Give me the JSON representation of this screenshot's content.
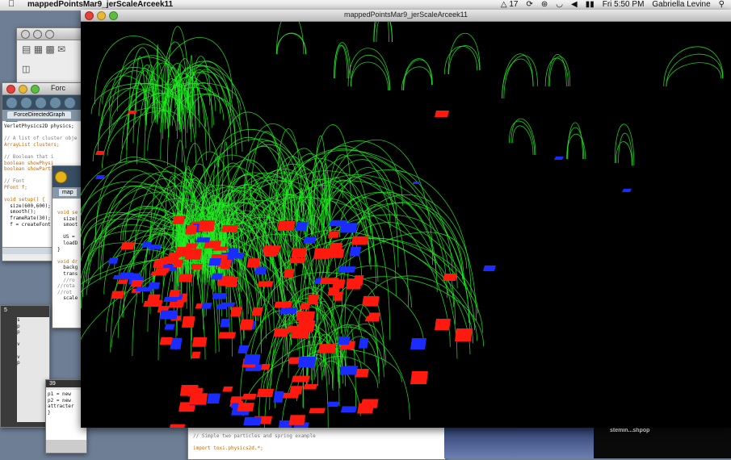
{
  "menubar": {
    "app_name": "mappedPointsMar9_jerScaleArceek11",
    "adobe_count": "17",
    "clock": "Fri 5:50 PM",
    "user": "Gabriella Levine"
  },
  "processing_window": {
    "title": "ForceDirectedGraph",
    "title_short": "Forc",
    "tab": "ForceDirectedGraph",
    "code_lines": [
      "VerletPhysics2D physics;",
      "",
      "// A list of cluster obje",
      "ArrayList clusters;",
      "",
      "// Boolean that i",
      "boolean showPhysi",
      "boolean showParti",
      "",
      "// Font",
      "PFont f;",
      "",
      "void setup() {",
      "  size(600,600);",
      "  smooth();",
      "  frameRate(30);",
      "  f = createFont("
    ]
  },
  "second_window": {
    "tab": "map",
    "code_lines": [
      "void se",
      "  size(",
      "  smoot",
      "",
      "  US = ",
      "  loadD",
      "}",
      "",
      "void dr",
      "  backg",
      "  trans",
      "  //ro",
      "//rota",
      "//rot",
      "  scale"
    ]
  },
  "third_window": {
    "line_number": "5",
    "code_lines": [
      "s",
      "p",
      "p",
      "",
      "v",
      "",
      "v",
      "p"
    ]
  },
  "fourth_window": {
    "line_number": "39",
    "code_lines": [
      "p1 = new",
      "p2 = new",
      "attracter",
      "}"
    ]
  },
  "bottom_window": {
    "code_lines": [
      "// Simple two particles and spring example",
      "",
      "import toxi.physics2d.*;"
    ]
  },
  "sketch_window": {
    "title": "mappedPointsMar9_jerScaleArceek11"
  },
  "dock_tooltip": "stemin...shpop",
  "colors": {
    "arc": "#22ee22",
    "red_tile": "#ff1a10",
    "blue_tile": "#1a2cff",
    "canvas_bg": "#000000"
  }
}
